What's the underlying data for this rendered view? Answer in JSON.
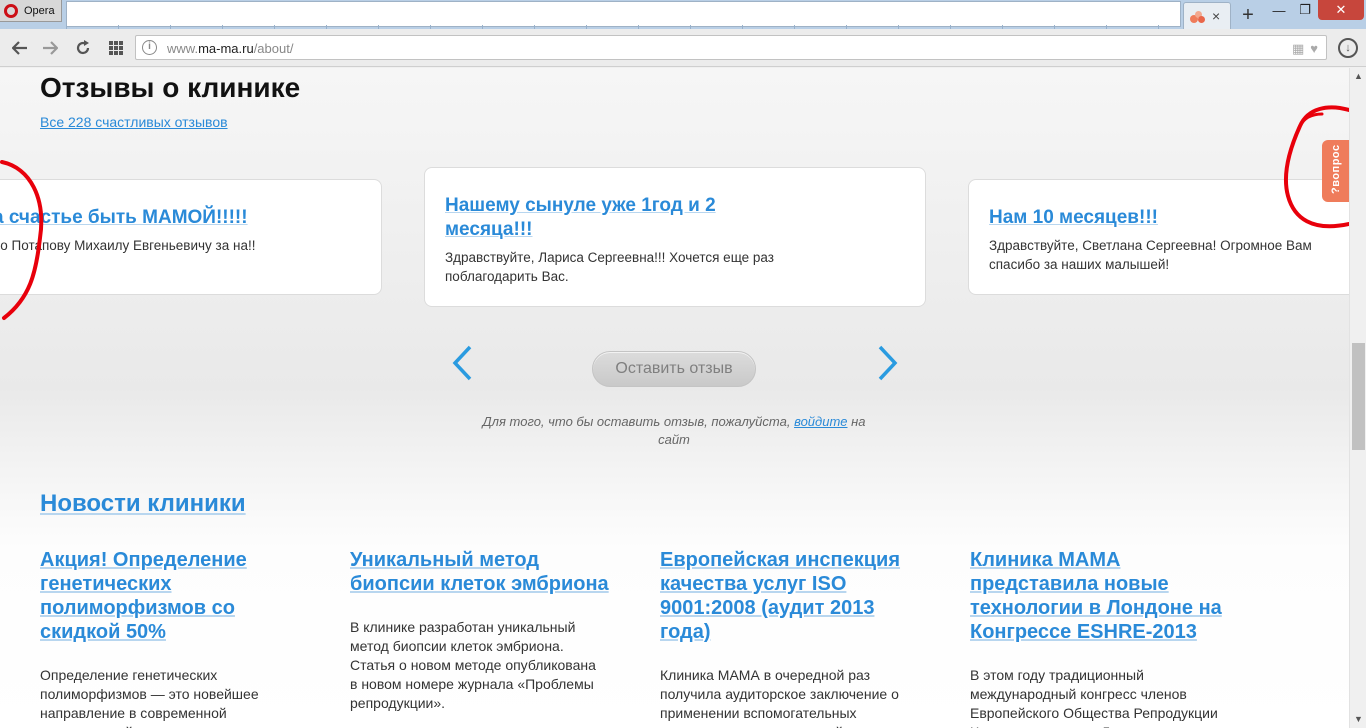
{
  "browser": {
    "name": "Opera",
    "tab_close_glyph": "×",
    "new_tab_glyph": "+",
    "window_min": "—",
    "window_max": "❐",
    "window_close": "✕",
    "url_prefix": "www.",
    "url_domain": "ma-ma.ru",
    "url_path": "/about/"
  },
  "reviews": {
    "heading": "Отзывы о клинике",
    "all_link": "Все 228 счастливых отзывов",
    "cards": [
      {
        "title": "а счастье быть МАМОЙ!!!!!",
        "text": "ибо Потапову Михаилу Евгеньевичу за на!!"
      },
      {
        "title": "Нашему сынуле уже 1год и 2 месяца!!!",
        "text": "Здравствуйте, Лариса Сергеевна!!! Хочется еще раз поблагодарить Вас."
      },
      {
        "title": "Нам 10 месяцев!!!",
        "text": "Здравствуйте, Светлана Сергеевна! Огромное Вам спасибо за наших малышей!"
      }
    ],
    "leave_button": "Оставить отзыв",
    "hint_before": "Для того, что бы оставить отзыв, пожалуйста,",
    "hint_link": "войдите",
    "hint_after": "на сайт"
  },
  "side_tab": {
    "label": "?вопрос"
  },
  "news": {
    "heading": "Новости клиники",
    "items": [
      {
        "title": "Акция! Определение генетических полиморфизмов со скидкой 50%",
        "text": "Определение генетических полиморфизмов — это новейшее направление в современной молекулярной медицине"
      },
      {
        "title": "Уникальный метод биопсии клеток эмбриона",
        "text": "В клинике разработан уникальный метод биопсии клеток эмбриона. Статья о новом методе опубликована в новом номере журнала «Проблемы репродукции»."
      },
      {
        "title": "Европейская инспекция качества услуг ISO 9001:2008 (аудит 2013 года)",
        "text": "Клиника МАМА в очередной раз получила аудиторское заключение о применении вспомогательных репродуктивных технологий для"
      },
      {
        "title": "Клиника МАМА представила новые технологии в Лондоне на Конгрессе ESHRE-2013",
        "text": "В этом году традиционный международный конгресс членов Европейского Общества Репродукции Человека прошел в Лондоне."
      }
    ]
  },
  "colors": {
    "link": "#2a8ad8",
    "accent_tab": "#ef7c5b",
    "annotation": "#e8000b"
  }
}
